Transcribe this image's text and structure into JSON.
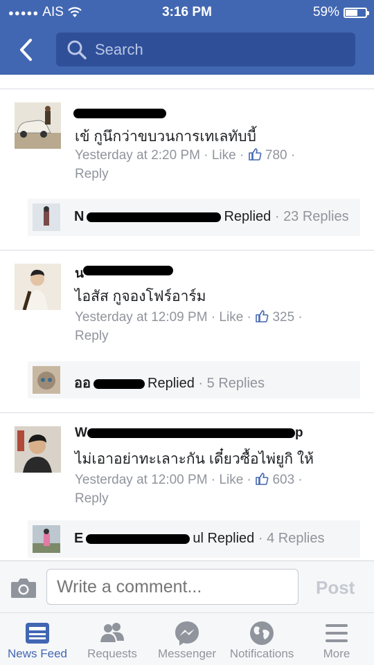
{
  "status_bar": {
    "carrier": "AIS",
    "time": "3:16 PM",
    "battery": "59%",
    "battery_level": 0.59
  },
  "search": {
    "placeholder": "Search"
  },
  "comments": [
    {
      "text": "เข้ กูนึกว่าขบวนการเทเลทับบี้",
      "timestamp": "Yesterday at 2:20 PM",
      "like_label": "Like",
      "like_count": "780",
      "reply_label": "Reply",
      "replied": {
        "name_prefix": "N",
        "name_suffix": "Replied",
        "count": "23 Replies"
      }
    },
    {
      "name_prefix": "น",
      "text": "ไอสัส กูจองโฟร์อาร์ม",
      "timestamp": "Yesterday at 12:09 PM",
      "like_label": "Like",
      "like_count": "325",
      "reply_label": "Reply",
      "replied": {
        "name_prefix": "ออ",
        "name_suffix": "Replied",
        "count": "5 Replies"
      }
    },
    {
      "name_prefix": "W",
      "name_suffix": "p",
      "text": "ไม่เอาอย่าทะเลาะกัน เดี๋ยวซื้อไพ่ยูกิ ให้",
      "timestamp": "Yesterday at 12:00 PM",
      "like_label": "Like",
      "like_count": "603",
      "reply_label": "Reply",
      "replied": {
        "name_prefix": "E",
        "name_suffix": "ul Replied",
        "count": "4 Replies"
      }
    }
  ],
  "composer": {
    "placeholder": "Write a comment...",
    "post_label": "Post"
  },
  "tabs": [
    {
      "label": "News Feed",
      "icon": "news-feed-icon",
      "active": true
    },
    {
      "label": "Requests",
      "icon": "friend-requests-icon",
      "active": false
    },
    {
      "label": "Messenger",
      "icon": "messenger-icon",
      "active": false
    },
    {
      "label": "Notifications",
      "icon": "globe-icon",
      "active": false
    },
    {
      "label": "More",
      "icon": "hamburger-menu-icon",
      "active": false
    }
  ],
  "colors": {
    "brand_blue": "#4267b2",
    "search_bg": "#2f4f99",
    "meta_gray": "#90949c"
  }
}
